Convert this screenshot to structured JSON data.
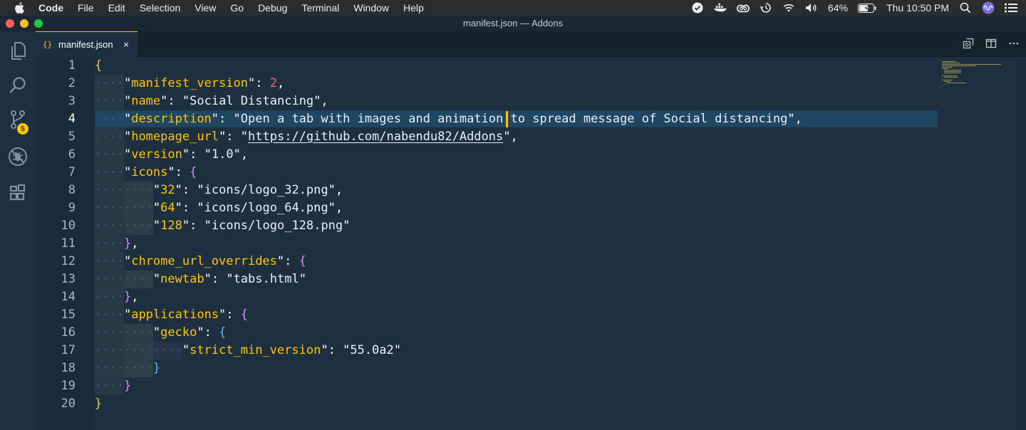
{
  "menubar": {
    "app_name": "Code",
    "items": [
      "File",
      "Edit",
      "Selection",
      "View",
      "Go",
      "Debug",
      "Terminal",
      "Window",
      "Help"
    ],
    "battery": "64%",
    "clock": "Thu 10:50 PM"
  },
  "window": {
    "title": "manifest.json — Addons"
  },
  "activity": {
    "source_control_badge": "5"
  },
  "tab": {
    "icon_text": "{}",
    "label": "manifest.json",
    "close": "×"
  },
  "editor": {
    "line_numbers": [
      "1",
      "2",
      "3",
      "4",
      "5",
      "6",
      "7",
      "8",
      "9",
      "10",
      "11",
      "12",
      "13",
      "14",
      "15",
      "16",
      "17",
      "18",
      "19",
      "20"
    ],
    "current_line": 4,
    "lines": [
      "{",
      "    \"manifest_version\": 2,",
      "    \"name\": \"Social Distancing\",",
      "    \"description\": \"Open a tab with images and animation to spread message of Social distancing\",",
      "    \"homepage_url\": \"https://github.com/nabendu82/Addons\",",
      "    \"version\": \"1.0\",",
      "    \"icons\": {",
      "        \"32\": \"icons/logo_32.png\",",
      "        \"64\": \"icons/logo_64.png\",",
      "        \"128\": \"icons/logo_128.png\"",
      "    },",
      "    \"chrome_url_overrides\": {",
      "        \"newtab\": \"tabs.html\"",
      "    },",
      "    \"applications\": {",
      "        \"gecko\": {",
      "            \"strict_min_version\": \"55.0a2\"",
      "        }",
      "    }",
      "}"
    ]
  },
  "colors": {
    "background": "#1e3040",
    "accent": "#ffc600",
    "key": "#ffc600",
    "string": "#a5ff90",
    "number": "#ff628c"
  }
}
